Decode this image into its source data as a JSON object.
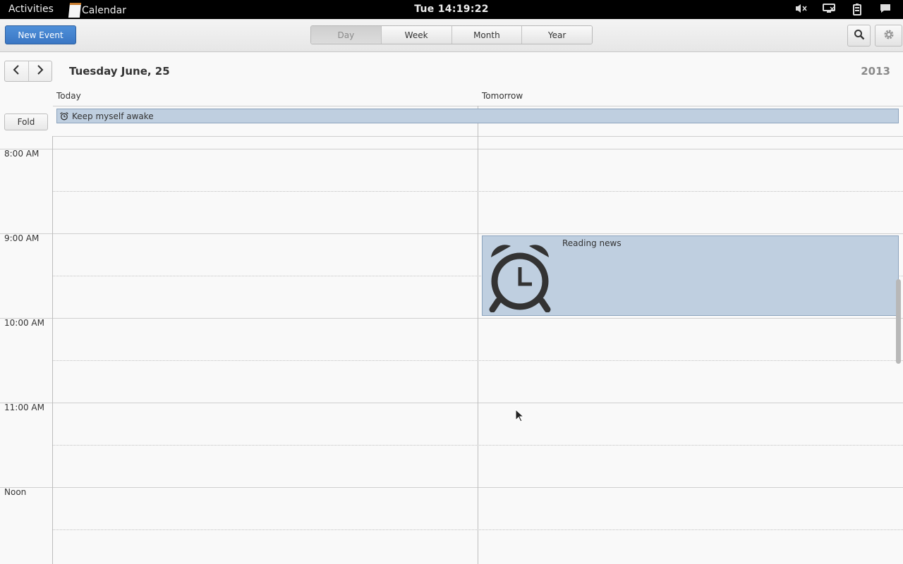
{
  "topbar": {
    "activities": "Activities",
    "app_name": "Calendar",
    "clock": "Tue 14:19:22",
    "tray_icons": [
      "volume-muted-icon",
      "network-icon",
      "battery-icon",
      "chat-icon"
    ]
  },
  "header": {
    "new_event": "New Event",
    "views": [
      "Day",
      "Week",
      "Month",
      "Year"
    ],
    "active_view": "Day",
    "search_icon": "search-icon",
    "settings_icon": "gear-icon"
  },
  "date_nav": {
    "title": "Tuesday June, 25",
    "year": "2013"
  },
  "columns": {
    "today": "Today",
    "tomorrow": "Tomorrow"
  },
  "fold_button": "Fold",
  "all_day_event": {
    "title": "Keep myself awake",
    "icon": "alarm-clock-icon"
  },
  "time_labels": [
    "8:00 AM",
    "9:00 AM",
    "10:00 AM",
    "11:00 AM",
    "Noon"
  ],
  "event": {
    "title": "Reading news",
    "icon": "alarm-clock-icon",
    "day": "Tomorrow",
    "start": "9:00 AM"
  },
  "colors": {
    "event_fill": "#bfcfe0",
    "event_border": "#8ca3bd",
    "accent": "#3a77c4"
  }
}
